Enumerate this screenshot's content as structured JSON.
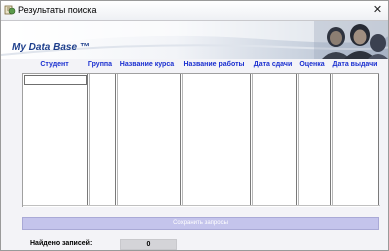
{
  "window": {
    "title": "Результаты поиска",
    "close_symbol": "✕"
  },
  "banner": {
    "title": "My Data Base ™"
  },
  "grid": {
    "columns": [
      "Студент",
      "Группа",
      "Название курса",
      "Название работы",
      "Дата сдачи",
      "Оценка",
      "Дата выдачи"
    ],
    "rows": []
  },
  "actions": {
    "save_label": "Сохранить запросы"
  },
  "status": {
    "found_label": "Найдено записей:",
    "found_count": "0"
  },
  "colors": {
    "header_text": "#1a2fd0",
    "banner_title": "#1e3f8c",
    "save_button_bg": "#c4c4ec"
  },
  "icons": {
    "app": "app-icon",
    "close": "close-icon",
    "banner_art": "banner-people-art"
  }
}
